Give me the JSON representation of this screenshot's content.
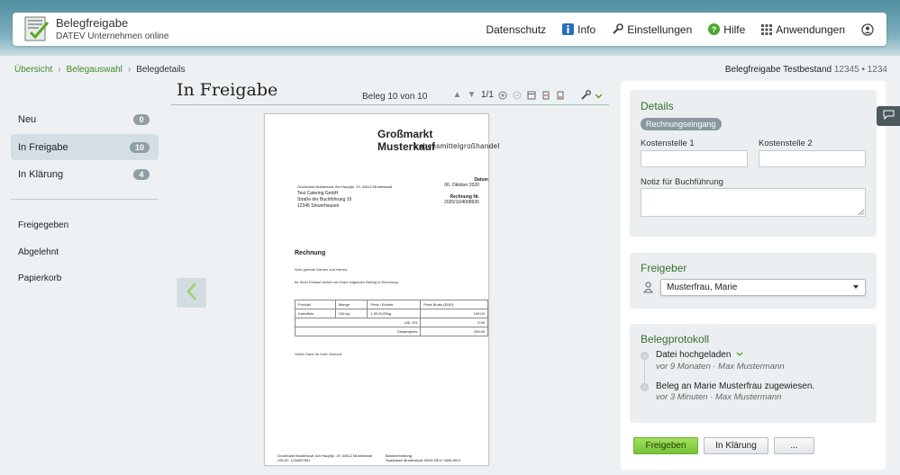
{
  "header": {
    "app_title": "Belegfreigabe",
    "app_subtitle": "DATEV Unternehmen online",
    "nav": {
      "datenschutz": "Datenschutz",
      "info": "Info",
      "einstellungen": "Einstellungen",
      "hilfe": "Hilfe",
      "anwendungen": "Anwendungen"
    }
  },
  "breadcrumb": [
    "Übersicht",
    "Belegauswahl",
    "Belegdetails"
  ],
  "testbestand": {
    "label": "Belegfreigabe Testbestand",
    "number": "12345 • 1234"
  },
  "sidebar": {
    "items": [
      {
        "label": "Neu",
        "count": "0"
      },
      {
        "label": "In Freigabe",
        "count": "10"
      },
      {
        "label": "In Klärung",
        "count": "4"
      }
    ],
    "links": [
      "Freigegeben",
      "Abgelehnt",
      "Papierkorb"
    ]
  },
  "document": {
    "title": "In Freigabe",
    "counter": "Beleg 10 von 10",
    "page_indicator": "1/1",
    "paper": {
      "brand": "Großmarkt Musterkauf",
      "brand_sub": "Lebensmittelgroßhandel",
      "sender_line": "Großmarkt Musterkauf, Am Hauptpl. 19, 34512 Musterstadt",
      "recipient": [
        "Test Catering GmbH",
        "Straße der Buchführung 15",
        "12345 Steuerhausen"
      ],
      "date_label": "Datum",
      "date_value": "06. Oktober 2020",
      "invoice_label": "Rechnung Nr.",
      "invoice_value": "2020/10/4008635",
      "heading": "Rechnung",
      "greeting": "Sehr geehrte Damen und Herren,",
      "intro": "für Ihren Einkauf stellen wir Ihnen folgenden Betrag in Rechnung:",
      "table": {
        "headers": [
          "Produkt",
          "Menge",
          "Preis / Einheit",
          "Preis Brutto (EUR)"
        ],
        "rows": [
          [
            "Kartoffeln",
            "100 kg",
            "1,99 EUR/kg",
            "199,00"
          ]
        ],
        "tax_label": "USt. 5%",
        "tax_value": "9,95",
        "total_label": "Gesamtpreis",
        "total_value": "208,95"
      },
      "thanks": "Vielen Dank für Ihren Einkauf.",
      "footer_left": [
        "Großmarkt Musterkauf, Am Hauptpl. 19, 34512 Musterstadt",
        "USt-ID: 1234567891"
      ],
      "footer_right": [
        "Bankverbindung:",
        "Sparkasse Musterstadt, IBAN DE12 3456 8911"
      ]
    }
  },
  "details": {
    "title": "Details",
    "chip": "Rechnungseingang",
    "kostenstelle1_label": "Kostenstelle 1",
    "kostenstelle2_label": "Kostenstelle 2",
    "notiz_label": "Notiz für Buchführung"
  },
  "freigeber": {
    "title": "Freigeber",
    "selected": "Musterfrau, Marie"
  },
  "protokoll": {
    "title": "Belegprotokoll",
    "entries": [
      {
        "title": "Datei hochgeladen",
        "meta": "vor 9 Monaten · Max Mustermann"
      },
      {
        "title": "Beleg an Marie Musterfrau zugewiesen.",
        "meta": "vor 3 Minuten · Max Mustermann"
      }
    ]
  },
  "actions": {
    "approve": "Freigeben",
    "clarify": "In Klärung",
    "more": "..."
  },
  "colors": {
    "accent_green": "#76c23a",
    "link_green": "#3f8a2c",
    "brand_yellow": "#f0b400"
  }
}
